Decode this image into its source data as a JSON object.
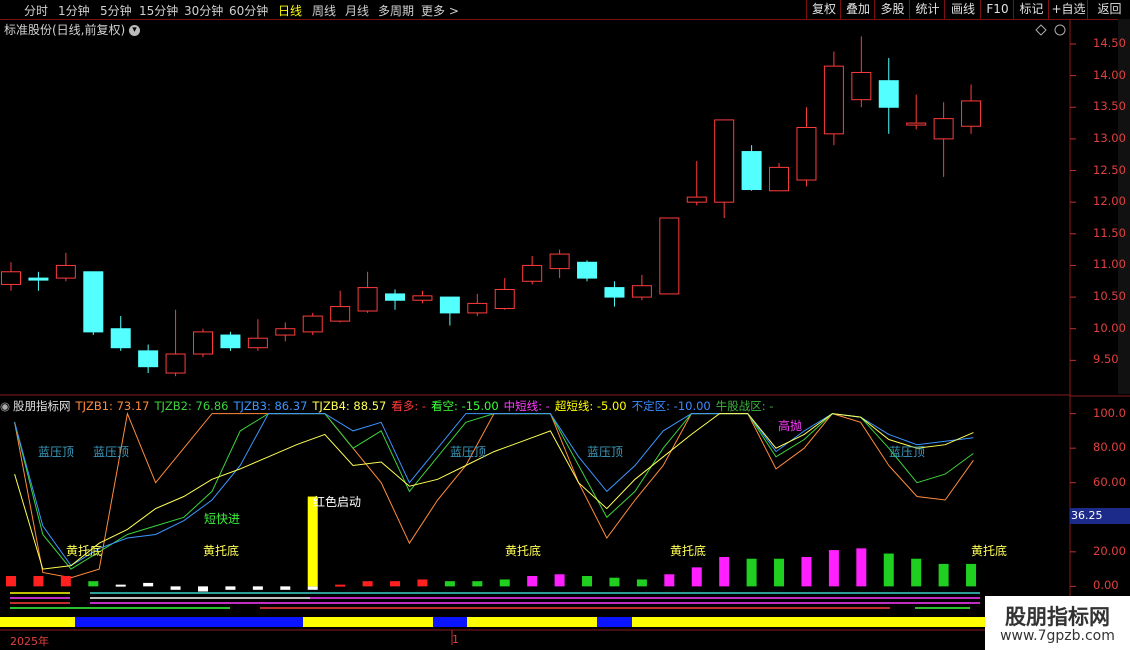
{
  "toolbar": {
    "timeframes": [
      "分时",
      "1分钟",
      "5分钟",
      "15分钟",
      "30分钟",
      "60分钟",
      "日线",
      "周线",
      "月线",
      "多周期",
      "更多 >"
    ],
    "active_timeframe": "日线",
    "buttons": [
      "复权",
      "叠加",
      "多股",
      "统计",
      "画线",
      "F10",
      "标记",
      "+自选",
      "返回"
    ]
  },
  "stock_title": "标准股份(日线,前复权)",
  "price_axis": [
    "14.50",
    "14.00",
    "13.50",
    "13.00",
    "12.50",
    "12.00",
    "11.50",
    "11.00",
    "10.50",
    "10.00",
    "9.50"
  ],
  "indicator": {
    "name": "股朋指标网",
    "fields": [
      {
        "label": "TJZB1: 73.17",
        "color": "#ff8c3c"
      },
      {
        "label": "TJZB2: 76.86",
        "color": "#3cd23c"
      },
      {
        "label": "TJZB3: 86.37",
        "color": "#3c96ff"
      },
      {
        "label": "TJZB4: 88.57",
        "color": "#ffff55"
      },
      {
        "label": "看多: -",
        "color": "#ff3c3c"
      },
      {
        "label": "看空: -15.00",
        "color": "#3cff3c"
      },
      {
        "label": "中短线: -",
        "color": "#ff3cff"
      },
      {
        "label": "超短线: -5.00",
        "color": "#ffff00"
      },
      {
        "label": "不定区: -10.00",
        "color": "#3c8cff"
      },
      {
        "label": "牛股战区: -",
        "color": "#3cb43c"
      }
    ],
    "axis": [
      "100.0",
      "80.00",
      "60.00",
      "40.00",
      "20.00",
      "0.00"
    ],
    "badge_value": "36.25",
    "annotations": [
      {
        "text": "蓝压顶",
        "color": "#3c9bbd"
      },
      {
        "text": "蓝压顶",
        "color": "#3c9bbd"
      },
      {
        "text": "蓝压顶",
        "color": "#3c9bbd"
      },
      {
        "text": "蓝压顶",
        "color": "#3c9bbd"
      },
      {
        "text": "蓝压顶",
        "color": "#3c9bbd"
      },
      {
        "text": "短快进",
        "color": "#3cf03c"
      },
      {
        "text": "红色启动",
        "color": "#ffffff"
      },
      {
        "text": "高抛",
        "color": "#ff3cff"
      },
      {
        "text": "黄托底",
        "color": "#ffff55"
      },
      {
        "text": "黄托底",
        "color": "#ffff55"
      },
      {
        "text": "黄托底",
        "color": "#ffff55"
      },
      {
        "text": "黄托底",
        "color": "#ffff55"
      },
      {
        "text": "黄托底",
        "color": "#ffff55"
      }
    ]
  },
  "timeline": {
    "year": "2025年",
    "month": "1"
  },
  "watermark": {
    "title": "股朋指标网",
    "url": "www.7gpzb.com"
  },
  "chart_data": {
    "type": "candlestick",
    "candles": [
      {
        "o": 10.7,
        "c": 10.9,
        "h": 11.05,
        "l": 10.6
      },
      {
        "o": 10.8,
        "c": 10.77,
        "h": 10.9,
        "l": 10.6
      },
      {
        "o": 10.8,
        "c": 11.0,
        "h": 11.2,
        "l": 10.75
      },
      {
        "o": 10.9,
        "c": 9.95,
        "h": 10.9,
        "l": 9.9
      },
      {
        "o": 10.0,
        "c": 9.7,
        "h": 10.2,
        "l": 9.65
      },
      {
        "o": 9.65,
        "c": 9.4,
        "h": 9.75,
        "l": 9.3
      },
      {
        "o": 9.3,
        "c": 9.6,
        "h": 10.3,
        "l": 9.25
      },
      {
        "o": 9.6,
        "c": 9.95,
        "h": 10.0,
        "l": 9.55
      },
      {
        "o": 9.9,
        "c": 9.7,
        "h": 9.95,
        "l": 9.65
      },
      {
        "o": 9.7,
        "c": 9.85,
        "h": 10.15,
        "l": 9.65
      },
      {
        "o": 9.9,
        "c": 10.0,
        "h": 10.1,
        "l": 9.8
      },
      {
        "o": 9.95,
        "c": 10.2,
        "h": 10.25,
        "l": 9.9
      },
      {
        "o": 10.12,
        "c": 10.35,
        "h": 10.6,
        "l": 10.1
      },
      {
        "o": 10.28,
        "c": 10.65,
        "h": 10.9,
        "l": 10.25
      },
      {
        "o": 10.55,
        "c": 10.45,
        "h": 10.62,
        "l": 10.3
      },
      {
        "o": 10.45,
        "c": 10.52,
        "h": 10.6,
        "l": 10.4
      },
      {
        "o": 10.5,
        "c": 10.25,
        "h": 10.5,
        "l": 10.05
      },
      {
        "o": 10.25,
        "c": 10.4,
        "h": 10.55,
        "l": 10.2
      },
      {
        "o": 10.32,
        "c": 10.62,
        "h": 10.8,
        "l": 10.3
      },
      {
        "o": 10.75,
        "c": 11.0,
        "h": 11.15,
        "l": 10.7
      },
      {
        "o": 10.95,
        "c": 11.18,
        "h": 11.25,
        "l": 10.8
      },
      {
        "o": 11.05,
        "c": 10.8,
        "h": 11.08,
        "l": 10.75
      },
      {
        "o": 10.65,
        "c": 10.5,
        "h": 10.75,
        "l": 10.35
      },
      {
        "o": 10.5,
        "c": 10.68,
        "h": 10.85,
        "l": 10.45
      },
      {
        "o": 10.55,
        "c": 11.75,
        "h": 11.75,
        "l": 10.55
      },
      {
        "o": 12.0,
        "c": 12.08,
        "h": 12.65,
        "l": 11.95
      },
      {
        "o": 12.0,
        "c": 13.3,
        "h": 13.3,
        "l": 11.75
      },
      {
        "o": 12.8,
        "c": 12.2,
        "h": 12.9,
        "l": 12.18
      },
      {
        "o": 12.18,
        "c": 12.55,
        "h": 12.62,
        "l": 12.18
      },
      {
        "o": 12.35,
        "c": 13.18,
        "h": 13.5,
        "l": 12.25
      },
      {
        "o": 13.08,
        "c": 14.15,
        "h": 14.38,
        "l": 12.9
      },
      {
        "o": 13.62,
        "c": 14.05,
        "h": 14.62,
        "l": 13.5
      },
      {
        "o": 13.92,
        "c": 13.5,
        "h": 14.28,
        "l": 13.08
      },
      {
        "o": 13.25,
        "c": 13.25,
        "h": 13.7,
        "l": 13.15
      },
      {
        "o": 13.0,
        "c": 13.32,
        "h": 13.58,
        "l": 12.4
      },
      {
        "o": 13.2,
        "c": 13.6,
        "h": 13.86,
        "l": 13.08
      }
    ],
    "price_ylim": [
      9.0,
      14.8
    ],
    "indicator_series": [
      {
        "name": "TJZB1",
        "color": "#ff8c3c",
        "values": [
          null,
          null,
          null,
          95,
          8,
          5,
          10,
          100,
          60,
          80,
          100,
          100,
          100,
          100,
          100,
          80,
          60,
          25,
          50,
          70,
          100,
          100,
          100,
          60,
          28,
          50,
          70,
          100,
          100,
          100,
          68,
          80,
          100,
          95,
          70,
          52,
          50,
          73
        ]
      },
      {
        "name": "TJZB2",
        "color": "#3cd23c",
        "values": [
          null,
          null,
          null,
          95,
          30,
          10,
          20,
          30,
          35,
          40,
          55,
          90,
          100,
          100,
          100,
          80,
          90,
          55,
          75,
          95,
          100,
          100,
          100,
          70,
          40,
          55,
          80,
          100,
          100,
          100,
          75,
          85,
          100,
          98,
          80,
          60,
          65,
          77
        ]
      },
      {
        "name": "TJZB3",
        "color": "#3c96ff",
        "values": [
          null,
          null,
          null,
          95,
          35,
          12,
          22,
          28,
          30,
          38,
          50,
          70,
          100,
          100,
          100,
          90,
          95,
          60,
          80,
          100,
          100,
          100,
          100,
          75,
          55,
          70,
          90,
          100,
          100,
          100,
          78,
          90,
          100,
          98,
          88,
          82,
          84,
          86
        ]
      },
      {
        "name": "TJZB4",
        "color": "#ffff55",
        "values": [
          null,
          null,
          null,
          65,
          10,
          12,
          25,
          33,
          45,
          52,
          62,
          68,
          75,
          82,
          88,
          70,
          72,
          58,
          62,
          70,
          78,
          84,
          90,
          60,
          45,
          62,
          75,
          88,
          100,
          100,
          80,
          88,
          100,
          98,
          85,
          80,
          82,
          89
        ]
      }
    ],
    "volume_bars": [
      {
        "v": 6,
        "color": "#ff2020"
      },
      {
        "v": 6,
        "color": "#ff2020"
      },
      {
        "v": 6,
        "color": "#ff2020"
      },
      {
        "v": 3,
        "color": "#20d020"
      },
      {
        "v": 1,
        "color": "#ffffff"
      },
      {
        "v": 2,
        "color": "#ffffff"
      },
      {
        "v": -2,
        "color": "#ffffff"
      },
      {
        "v": -3,
        "color": "#ffffff"
      },
      {
        "v": -2,
        "color": "#ffffff"
      },
      {
        "v": -2,
        "color": "#ffffff"
      },
      {
        "v": -2,
        "color": "#ffffff"
      },
      {
        "v": -2,
        "color": "#ffffff"
      },
      {
        "v": 1,
        "color": "#ff2020"
      },
      {
        "v": 3,
        "color": "#ff2020"
      },
      {
        "v": 3,
        "color": "#ff2020"
      },
      {
        "v": 4,
        "color": "#ff2020"
      },
      {
        "v": 3,
        "color": "#20d020"
      },
      {
        "v": 3,
        "color": "#20d020"
      },
      {
        "v": 4,
        "color": "#20d020"
      },
      {
        "v": 6,
        "color": "#ff20ff"
      },
      {
        "v": 7,
        "color": "#ff20ff"
      },
      {
        "v": 6,
        "color": "#20d020"
      },
      {
        "v": 5,
        "color": "#20d020"
      },
      {
        "v": 4,
        "color": "#20d020"
      },
      {
        "v": 7,
        "color": "#ff20ff"
      },
      {
        "v": 11,
        "color": "#ff20ff"
      },
      {
        "v": 17,
        "color": "#ff20ff"
      },
      {
        "v": 16,
        "color": "#20d020"
      },
      {
        "v": 16,
        "color": "#20d020"
      },
      {
        "v": 17,
        "color": "#ff20ff"
      },
      {
        "v": 21,
        "color": "#ff20ff"
      },
      {
        "v": 22,
        "color": "#ff20ff"
      },
      {
        "v": 19,
        "color": "#20d020"
      },
      {
        "v": 16,
        "color": "#20d020"
      },
      {
        "v": 13,
        "color": "#20d020"
      },
      {
        "v": 13,
        "color": "#20d020"
      }
    ],
    "signal_bar": {
      "index": 11,
      "value": 52,
      "color": "#ffff00"
    },
    "indicator_ylim": [
      -5,
      105
    ]
  }
}
